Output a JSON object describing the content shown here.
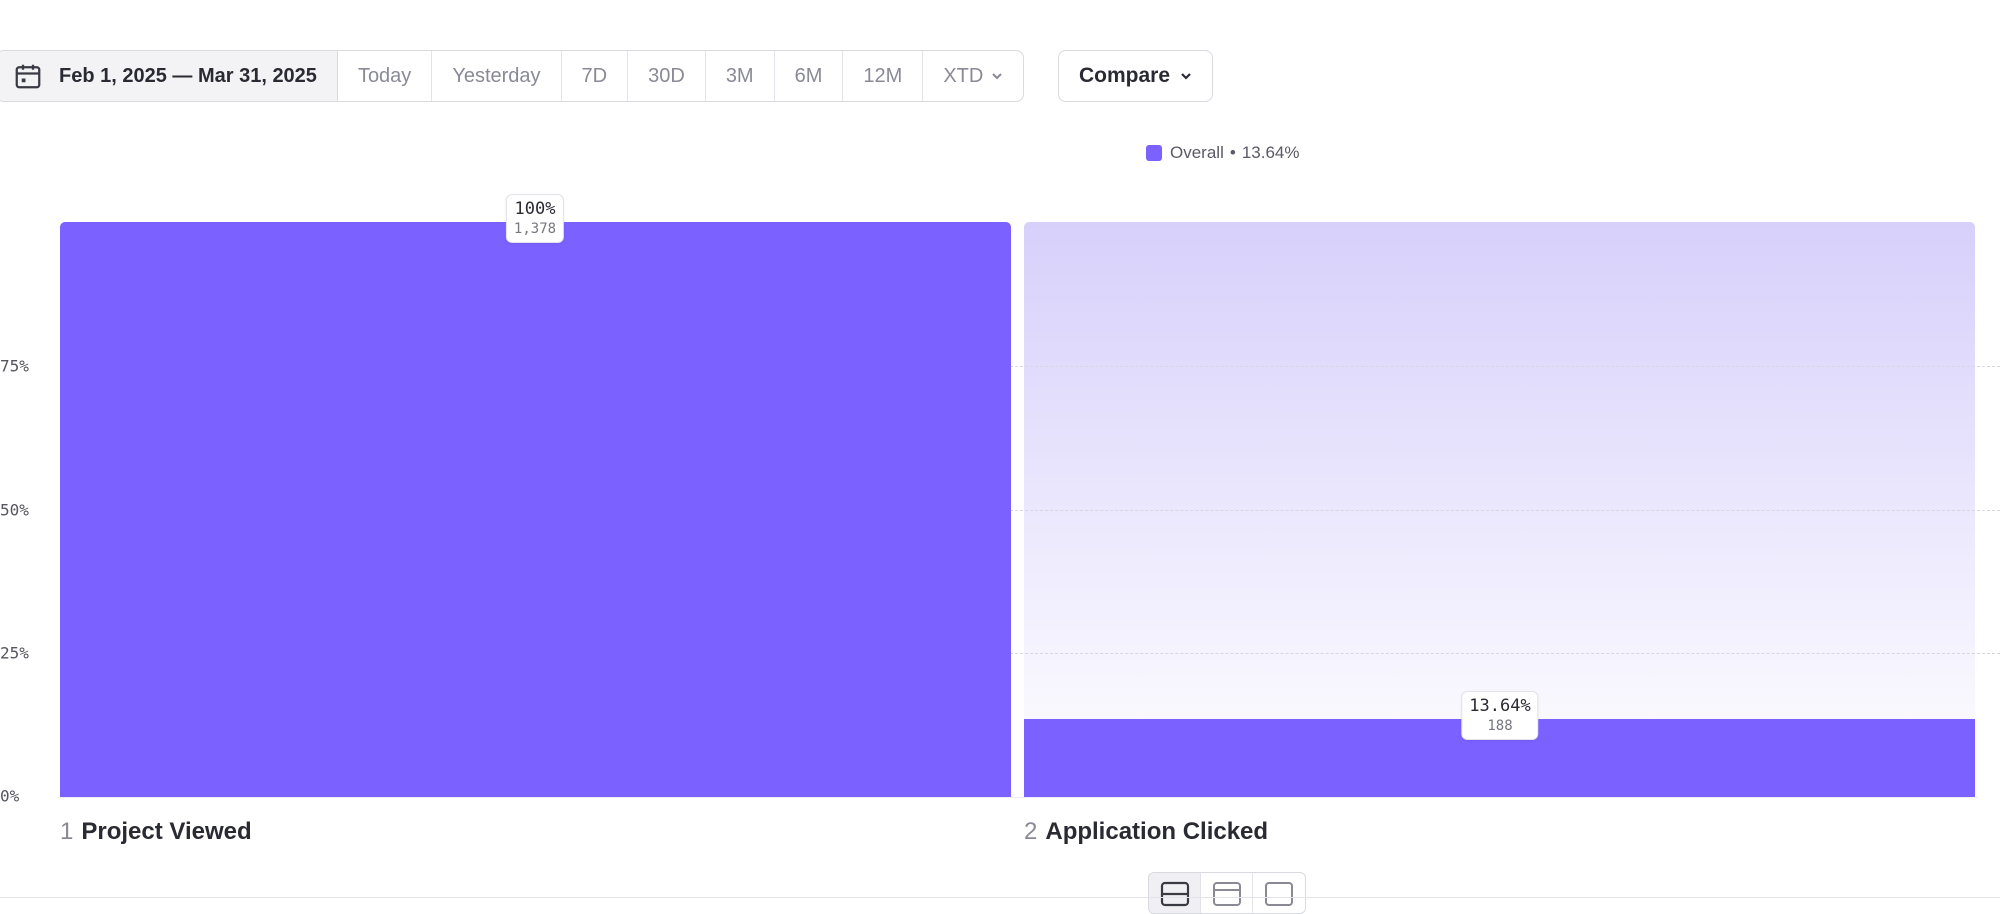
{
  "toolbar": {
    "date_range": "Feb 1, 2025 — Mar 31, 2025",
    "presets": [
      "Today",
      "Yesterday",
      "7D",
      "30D",
      "3M",
      "6M",
      "12M",
      "XTD"
    ],
    "compare_label": "Compare"
  },
  "legend": {
    "label": "Overall",
    "separator": "•",
    "value": "13.64%"
  },
  "colors": {
    "bar": "#7b61ff",
    "bar_bg_top": "#d7d0fb",
    "bar_bg_bottom": "#ffffff"
  },
  "icons": {
    "date": "calendar-icon",
    "dropdown": "chevron-down-icon",
    "views": [
      "stacked-view-icon",
      "split-view-icon",
      "single-view-icon"
    ]
  },
  "chart_data": {
    "type": "bar",
    "categories": [
      "Project Viewed",
      "Application Clicked"
    ],
    "step_numbers": [
      "1",
      "2"
    ],
    "values": [
      100,
      13.64
    ],
    "value_labels": [
      "100%",
      "13.64%"
    ],
    "counts": [
      "1,378",
      "188"
    ],
    "ylim": [
      0,
      100
    ],
    "yticks": [
      {
        "value": 75,
        "label": "75%"
      },
      {
        "value": 50,
        "label": "50%"
      },
      {
        "value": 25,
        "label": "25%"
      },
      {
        "value": 0,
        "label": "0%"
      }
    ],
    "grid": true,
    "legend_position": "top-center"
  }
}
